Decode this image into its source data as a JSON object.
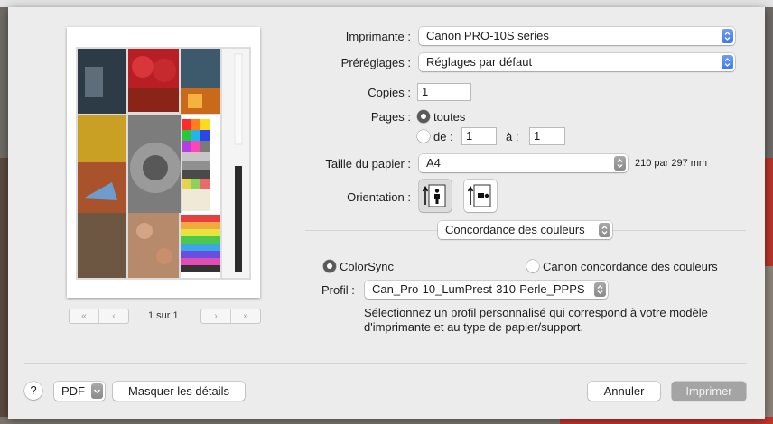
{
  "printer": {
    "label": "Imprimante :",
    "value": "Canon PRO-10S series"
  },
  "presets": {
    "label": "Préréglages :",
    "value": "Réglages par défaut"
  },
  "copies": {
    "label": "Copies :",
    "value": "1"
  },
  "pages": {
    "label": "Pages :",
    "all_label": "toutes",
    "from_label": "de :",
    "from_value": "1",
    "to_label": "à :",
    "to_value": "1",
    "selected": "all"
  },
  "paper_size": {
    "label": "Taille du papier :",
    "value": "A4",
    "dimensions": "210 par 297 mm"
  },
  "orientation": {
    "label": "Orientation :",
    "selected": "portrait"
  },
  "section_menu": {
    "value": "Concordance des couleurs"
  },
  "color_matching": {
    "option_colorsync": "ColorSync",
    "option_canon": "Canon concordance des couleurs",
    "selected": "colorsync",
    "profile_label": "Profil :",
    "profile_value": "Can_Pro-10_LumPrest-310-Perle_PPPS",
    "description": "Sélectionnez un profil personnalisé qui correspond à votre modèle d'imprimante et au type de papier/support."
  },
  "preview": {
    "page_indicator": "1 sur 1",
    "first_glyph": "«",
    "prev_glyph": "‹",
    "next_glyph": "›",
    "last_glyph": "»"
  },
  "footer": {
    "help_label": "?",
    "pdf_label": "PDF",
    "hide_details_label": "Masquer les détails",
    "cancel_label": "Annuler",
    "print_label": "Imprimer"
  },
  "colors": {
    "accent": "#3c78ee",
    "sheet_bg": "#ececec"
  }
}
